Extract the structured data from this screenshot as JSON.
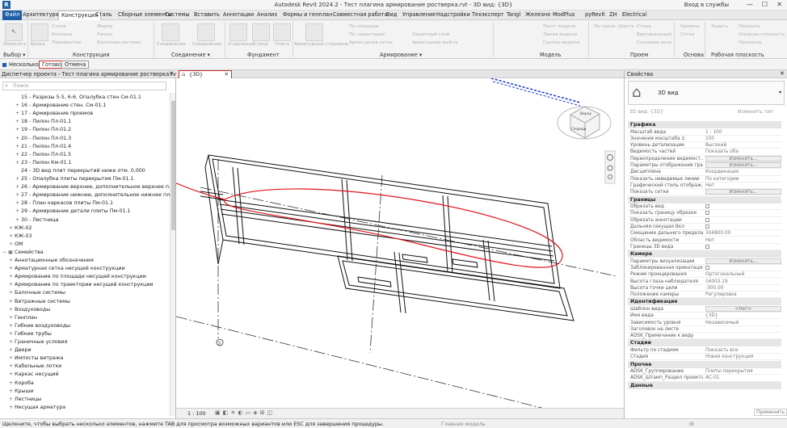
{
  "window": {
    "title": "Autodesk Revit 2024.2 - Тест плагина армирование ростверка.rvt - 3D вид: {3D}",
    "sign_in": "Вход в службы",
    "controls": [
      "—",
      "☐",
      "✕"
    ]
  },
  "ribbon_tabs": [
    {
      "label": "Файл",
      "type": "file"
    },
    {
      "label": "Архитектура"
    },
    {
      "label": "Конструкция",
      "active": true
    },
    {
      "label": "Сталь"
    },
    {
      "label": "Сборные элементы"
    },
    {
      "label": "Системы"
    },
    {
      "label": "Вставить"
    },
    {
      "label": "Аннотации"
    },
    {
      "label": "Анализ"
    },
    {
      "label": "Формы и генплан"
    },
    {
      "label": "Совместная работа"
    },
    {
      "label": "Вид"
    },
    {
      "label": "Управление"
    },
    {
      "label": "Надстройки"
    },
    {
      "label": "Техэксперт"
    },
    {
      "label": "Tangl"
    },
    {
      "label": "Железно"
    },
    {
      "label": "ModPlus"
    },
    {
      "label": "pyRevit"
    },
    {
      "label": "ZH"
    },
    {
      "label": "Electrical"
    }
  ],
  "ribbon": {
    "tools": {
      "modify": "Изменить",
      "beam": "Балка",
      "wall": "Стена",
      "column": "Колонна",
      "floor": "Перекрытие",
      "truss": "Ферма",
      "brace": "Раскос",
      "beam_system": "Балочная система",
      "connection": "Соединение",
      "connections": "Соединения",
      "isolated": "Отдельный",
      "wall_found": "Стена",
      "slab": "Плита",
      "rebar": "Арматурный стержень",
      "area": "По площади",
      "path": "По траектории",
      "fabric": "Арматурная сетка",
      "coupler": "Защитный слой",
      "cover": "Арматурная муфта",
      "model_text": "Текст модели",
      "model_line": "Линия модели",
      "model_group": "Группа модели",
      "opening_face": "По грани",
      "shaft": "Шахта",
      "wall_open": "Стена",
      "vertical": "Вертикальный",
      "dormer": "Слуховое окно",
      "level": "Уровень",
      "grid": "Сетка",
      "set": "Задать",
      "show": "Показать",
      "ref_plane": "Опорная плоскость",
      "viewer": "Просмотр"
    },
    "panels": [
      {
        "label": "Выбор ▾"
      },
      {
        "label": "Конструкция"
      },
      {
        "label": "Соединение ▾"
      },
      {
        "label": "Фундамент"
      },
      {
        "label": "Армирование ▾"
      },
      {
        "label": "Модель"
      },
      {
        "label": "Проем"
      },
      {
        "label": "Основа"
      },
      {
        "label": "Рабочая плоскость"
      }
    ]
  },
  "options_bar": {
    "multiple_label": "Несколько",
    "finish_label": "Готово",
    "cancel_label": "Отмена"
  },
  "project_browser": {
    "header": "Диспетчер проекта - Тест плагина армирование ростверка.rvt",
    "search_placeholder": "Поиск",
    "items": [
      {
        "label": "15 - Разрезы 5-5, 6-6. Опалубка стен См-01.1",
        "level": 2,
        "expand": ""
      },
      {
        "label": "16 - Армирование стен. См-01.1",
        "level": 2,
        "expand": "+"
      },
      {
        "label": "17 - Армирование проемов",
        "level": 2,
        "expand": "+"
      },
      {
        "label": "18 - Пилон Пл-01.1",
        "level": 2,
        "expand": "+"
      },
      {
        "label": "19 - Пилон Пл-01.2",
        "level": 2,
        "expand": "+"
      },
      {
        "label": "20 - Пилон Пл-01.3",
        "level": 2,
        "expand": "+"
      },
      {
        "label": "21 - Пилон Пл-01.4",
        "level": 2,
        "expand": "+"
      },
      {
        "label": "22 - Пилон Пл-01.5",
        "level": 2,
        "expand": "+"
      },
      {
        "label": "23 - Пилон Км-01.1",
        "level": 2,
        "expand": "+"
      },
      {
        "label": "24 - 3D вид плит перекрытий ниже отм. 0,000",
        "level": 2,
        "expand": ""
      },
      {
        "label": "25 - Опалубка плиты перекрытия Пм-01.1",
        "level": 2,
        "expand": "+"
      },
      {
        "label": "26 - Армирование верхнее, дополнительное верхнее плиты пере",
        "level": 2,
        "expand": "+"
      },
      {
        "label": "27 - Армирование нижнее, дополнительное нижнее плиты перек",
        "level": 2,
        "expand": "+"
      },
      {
        "label": "28 - План каркасов плиты Пм-01.1",
        "level": 2,
        "expand": "+"
      },
      {
        "label": "29 - Армирование детали плиты Пм-01.1",
        "level": 2,
        "expand": "+"
      },
      {
        "label": "30 - Лестница",
        "level": 2,
        "expand": "+"
      },
      {
        "label": "КЖ-02",
        "level": 1,
        "expand": "+"
      },
      {
        "label": "КЖ-03",
        "level": 1,
        "expand": "+"
      },
      {
        "label": "ОМ",
        "level": 1,
        "expand": "+"
      },
      {
        "label": "Семейства",
        "level": 0,
        "expand": "−",
        "icon": true
      },
      {
        "label": "Аннотационные обозначения",
        "level": 1,
        "expand": "+"
      },
      {
        "label": "Арматурная сетка несущей конструкции",
        "level": 1,
        "expand": "+"
      },
      {
        "label": "Армирование по площади несущей конструкции",
        "level": 1,
        "expand": "+"
      },
      {
        "label": "Армирование по траектории несущей конструкции",
        "level": 1,
        "expand": "+"
      },
      {
        "label": "Балочные системы",
        "level": 1,
        "expand": "+"
      },
      {
        "label": "Витражные системы",
        "level": 1,
        "expand": "+"
      },
      {
        "label": "Воздуховоды",
        "level": 1,
        "expand": "+"
      },
      {
        "label": "Генплан",
        "level": 1,
        "expand": "+"
      },
      {
        "label": "Гибкие воздуховоды",
        "level": 1,
        "expand": "+"
      },
      {
        "label": "Гибкие трубы",
        "level": 1,
        "expand": "+"
      },
      {
        "label": "Граничные условия",
        "level": 1,
        "expand": "+"
      },
      {
        "label": "Двери",
        "level": 1,
        "expand": "+"
      },
      {
        "label": "Импосты витража",
        "level": 1,
        "expand": "+"
      },
      {
        "label": "Кабельные лотки",
        "level": 1,
        "expand": "+"
      },
      {
        "label": "Каркас несущий",
        "level": 1,
        "expand": "+"
      },
      {
        "label": "Короба",
        "level": 1,
        "expand": "+"
      },
      {
        "label": "Крыши",
        "level": 1,
        "expand": "+"
      },
      {
        "label": "Лестницы",
        "level": 1,
        "expand": "+"
      },
      {
        "label": "Несущая арматура",
        "level": 1,
        "expand": "+"
      }
    ]
  },
  "view": {
    "tab_label": "{3D}",
    "tab_close": "✕",
    "scale": "1 : 100",
    "viewcube_top": "Верху",
    "viewcube_front": "Спереди",
    "grid_bubble": "5"
  },
  "properties": {
    "header": "Свойства",
    "type_name": "3D вид",
    "instance_label": "3D вид: {3D}",
    "edit_type": "Изменить тип",
    "apply": "Применить",
    "groups": [
      {
        "title": "Графика",
        "rows": [
          {
            "k": "Масштаб вида",
            "v": "1 : 100"
          },
          {
            "k": "Значение масштаба    1:",
            "v": "100"
          },
          {
            "k": "Уровень детализации",
            "v": "Высокий"
          },
          {
            "k": "Видимость частей",
            "v": "Показать оба"
          },
          {
            "k": "Переопределения видимост...",
            "v": "Изменить...",
            "btn": true
          },
          {
            "k": "Параметры отображения гра...",
            "v": "Изменить...",
            "btn": true
          },
          {
            "k": "Дисциплина",
            "v": "Координация"
          },
          {
            "k": "Показать невидимые линии",
            "v": "По категории"
          },
          {
            "k": "Графический стиль отображ...",
            "v": "Нет"
          },
          {
            "k": "Показать сетки",
            "v": "Изменить...",
            "btn": true
          }
        ]
      },
      {
        "title": "Границы",
        "rows": [
          {
            "k": "Обрезать вид",
            "v": "",
            "cb": true
          },
          {
            "k": "Показать границу обрезки",
            "v": "",
            "cb": true
          },
          {
            "k": "Обрезать аннотации",
            "v": "",
            "cb": true
          },
          {
            "k": "Дальняя секущая Вкл",
            "v": "",
            "cb": true
          },
          {
            "k": "Смещение дальнего предела...",
            "v": "304800.00"
          },
          {
            "k": "Область видимости",
            "v": "Нет"
          },
          {
            "k": "Границы 3D вида",
            "v": "",
            "cb": true
          }
        ]
      },
      {
        "title": "Камера",
        "rows": [
          {
            "k": "Параметры визуализации",
            "v": "Изменить...",
            "btn": true
          },
          {
            "k": "Заблокированная ориентация",
            "v": "",
            "cb": true
          },
          {
            "k": "Режим проецирования",
            "v": "Ортогональный"
          },
          {
            "k": "Высота глаза наблюдателя",
            "v": "16003.19"
          },
          {
            "k": "Высота точки цели",
            "v": "-300.00"
          },
          {
            "k": "Положение камеры",
            "v": "Регулировка"
          }
        ]
      },
      {
        "title": "Идентификация",
        "rows": [
          {
            "k": "Шаблон вида",
            "v": "<Нет>",
            "btn": true
          },
          {
            "k": "Имя вида",
            "v": "{3D}"
          },
          {
            "k": "Зависимость уровня",
            "v": "Независимый"
          },
          {
            "k": "Заголовок на листе",
            "v": ""
          },
          {
            "k": "ADSK_Примечание к виду",
            "v": ""
          }
        ]
      },
      {
        "title": "Стадии",
        "rows": [
          {
            "k": "Фильтр по стадиям",
            "v": "Показать все"
          },
          {
            "k": "Стадия",
            "v": "Новая конструкция"
          }
        ]
      },
      {
        "title": "Прочее",
        "rows": [
          {
            "k": "ADSK_Группирование",
            "v": "Плиты перекрытия"
          },
          {
            "k": "ADSK_Штамп_Раздел проекта",
            "v": "АС-01"
          }
        ]
      },
      {
        "title": "Данные",
        "rows": []
      }
    ]
  },
  "status": {
    "text": "Щелкните, чтобы выбрать несколько элементов, нажмите TAB для просмотра возможных вариантов или ESC для завершения процедуры.",
    "model": "Главная модель",
    "zero": ":0"
  },
  "colors": {
    "accent": "#1f5fa6",
    "annotation": "#e0141e",
    "selection_blue": "#1f3fd8"
  }
}
